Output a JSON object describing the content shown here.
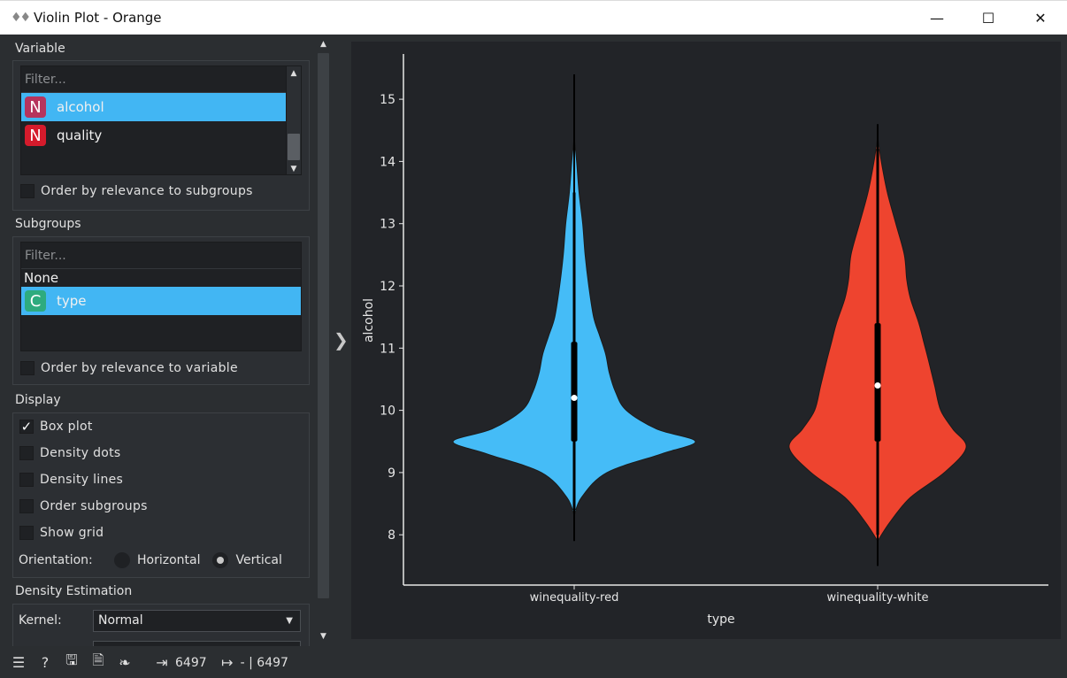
{
  "window": {
    "title": "Violin Plot - Orange",
    "minimize": "—",
    "maximize": "☐",
    "close": "✕"
  },
  "variable": {
    "title": "Variable",
    "filter_placeholder": "Filter...",
    "items": [
      {
        "badge": "N",
        "label": "alcohol",
        "selected": true
      },
      {
        "badge": "N",
        "label": "quality",
        "selected": false
      }
    ],
    "order_label": "Order by relevance to subgroups"
  },
  "subgroups": {
    "title": "Subgroups",
    "filter_placeholder": "Filter...",
    "none_label": "None",
    "items": [
      {
        "badge": "C",
        "label": "type",
        "selected": true
      }
    ],
    "order_label": "Order by relevance to variable"
  },
  "display": {
    "title": "Display",
    "box_plot": {
      "label": "Box plot",
      "checked": true
    },
    "density_dots": {
      "label": "Density dots",
      "checked": false
    },
    "density_lines": {
      "label": "Density lines",
      "checked": false
    },
    "order_subgroups": {
      "label": "Order subgroups",
      "checked": false
    },
    "show_grid": {
      "label": "Show grid",
      "checked": false
    },
    "orientation_label": "Orientation:",
    "orientation_horizontal": "Horizontal",
    "orientation_vertical": "Vertical",
    "orientation_selected": "Vertical"
  },
  "density": {
    "title": "Density Estimation",
    "kernel_label": "Kernel:",
    "kernel_value": "Normal"
  },
  "status": {
    "input_count": "6497",
    "output_count": "- | 6497"
  },
  "chart_data": {
    "type": "violin",
    "xlabel": "type",
    "ylabel": "alcohol",
    "ylim": [
      7.3,
      15.7
    ],
    "yticks": [
      8,
      9,
      10,
      11,
      12,
      13,
      14,
      15
    ],
    "grid": false,
    "categories": [
      "winequality-red",
      "winequality-white"
    ],
    "series": [
      {
        "color": "#45bcf7",
        "density_y": [
          8.3,
          8.6,
          9.0,
          9.3,
          9.5,
          9.7,
          10.0,
          10.3,
          10.6,
          10.9,
          11.2,
          11.5,
          12.0,
          12.5,
          13.0,
          13.5,
          14.0,
          14.4
        ],
        "density_width": [
          0.0,
          0.06,
          0.27,
          0.72,
          1.0,
          0.68,
          0.43,
          0.34,
          0.29,
          0.26,
          0.21,
          0.16,
          0.12,
          0.09,
          0.07,
          0.04,
          0.02,
          0.0
        ],
        "whisker_low": 7.9,
        "whisker_high": 15.4,
        "q1": 9.5,
        "q3": 11.1,
        "median": 10.2,
        "whisker_box_low": 8.4,
        "whisker_box_high": 13.5
      },
      {
        "color": "#ee442f",
        "density_y": [
          7.9,
          8.2,
          8.6,
          9.0,
          9.4,
          9.7,
          10.0,
          10.4,
          10.8,
          11.1,
          11.4,
          11.8,
          12.1,
          12.5,
          13.0,
          13.5,
          14.0,
          14.4
        ],
        "density_width": [
          0.0,
          0.1,
          0.27,
          0.55,
          0.73,
          0.62,
          0.52,
          0.47,
          0.42,
          0.38,
          0.34,
          0.27,
          0.24,
          0.22,
          0.15,
          0.08,
          0.03,
          0.0
        ],
        "whisker_low": 7.5,
        "whisker_high": 14.6,
        "q1": 9.5,
        "q3": 11.4,
        "median": 10.4,
        "whisker_box_low": 8.0,
        "whisker_box_high": 14.2
      }
    ]
  }
}
